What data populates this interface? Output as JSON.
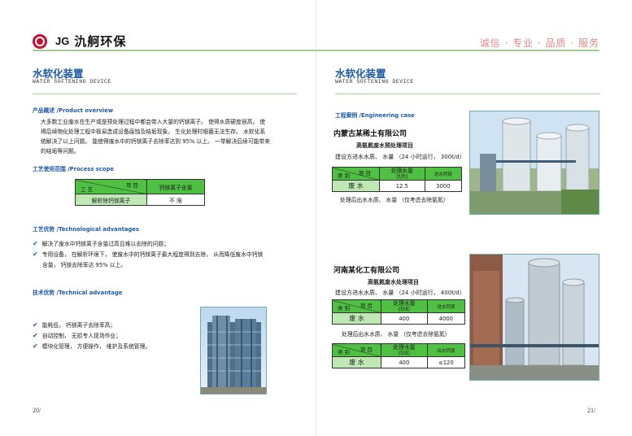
{
  "header": {
    "logo_letters": "JG",
    "company_name": "氿舸环保",
    "slogan": "诚信 · 专业 · 品质 · 服务"
  },
  "left": {
    "title": "水软化装置",
    "subtitle": "WATER SOFTENING DEVICE",
    "overview_label": "产品概述 /Product overview",
    "overview_lines": [
      "大多数工业废水在生产或是预处理过程中都会带入大量的钙镁离子。 使得水质硬度很高。 使",
      "得后续物化处理工程中极易造成设备腐蚀及结垢现象。 生化处理时细菌无法生存。 水软化系",
      "统解决了以上问题。 能使得废水中的钙镁离子去除率达到 95% 以上。 一举解决后续可能带来",
      "的结垢等问题。"
    ],
    "scope_label": "工艺使用范围 /Process scope",
    "scope_table": {
      "diag_top": "项 目",
      "diag_bottom": "工 艺",
      "col_header": "钙镁离子含量",
      "row_label": "解析除钙镁离子",
      "row_value": "不 限"
    },
    "tech_label": "工艺优势 /Technological advantages",
    "tech_items": [
      "解决了废水中钙镁离子含量过高且难以去除的问题；",
      "专用设备， 在解析环境下， 使废水中的钙镁离子最大程度得到去除， 从而降低废水中钙镁",
      "含量， 钙镁去除率达 95% 以上。"
    ],
    "adv_label": "技术优势 /Technical advantage",
    "adv_items": [
      "能耗低， 钙镁离子去除率高；",
      "自动控制， 无损专人现场作业；",
      "模块化管理， 方便操作， 维护及系统管理。"
    ],
    "page_number": "20/"
  },
  "right": {
    "title": "水软化装置",
    "subtitle": "WATER SOFTENING DEVICE",
    "case_label": "工程案例 /Engineering case",
    "case1": {
      "company": "内蒙古某稀土有限公司",
      "project": "高氨氮废水预处理项目",
      "design": "建设方进水水质、 水量 （24 小时运行， 300t/d）",
      "diag_top": "项 目",
      "diag_bottom": "类 别",
      "col1": "处理水量",
      "col1_unit": "（t/h）",
      "col2": "进水钙镁",
      "row_label": "废 水",
      "row_v1": "12.5",
      "row_v2": "3000",
      "after": "处理后出水水质、 水量 （仅考虑去除氨氮）"
    },
    "case2": {
      "company": "河南某化工有限公司",
      "project": "高氨氮废水处理项目",
      "design": "建设方进水水质、 水量 （24 小时运行， 400t/d）",
      "diag_top": "项 目",
      "diag_bottom": "类 别",
      "col1": "处理水量",
      "col1_unit": "（t/d）",
      "col2": "进水钙镁",
      "row_label": "废 水",
      "row_v1": "400",
      "row_v2": "4000",
      "after": "处理后出水水质、 水量 （仅考虑去除氨氮）",
      "t2_col2": "出水钙镁",
      "t2_v1": "400",
      "t2_v2": "≤120"
    },
    "page_number": "21/"
  },
  "colors": {
    "accent_blue": "#1e5aa8",
    "table_green": "#4ec042",
    "rule_green": "#9fd18f",
    "logo_red": "#c8102e",
    "slogan_pink": "#e08a8a"
  }
}
